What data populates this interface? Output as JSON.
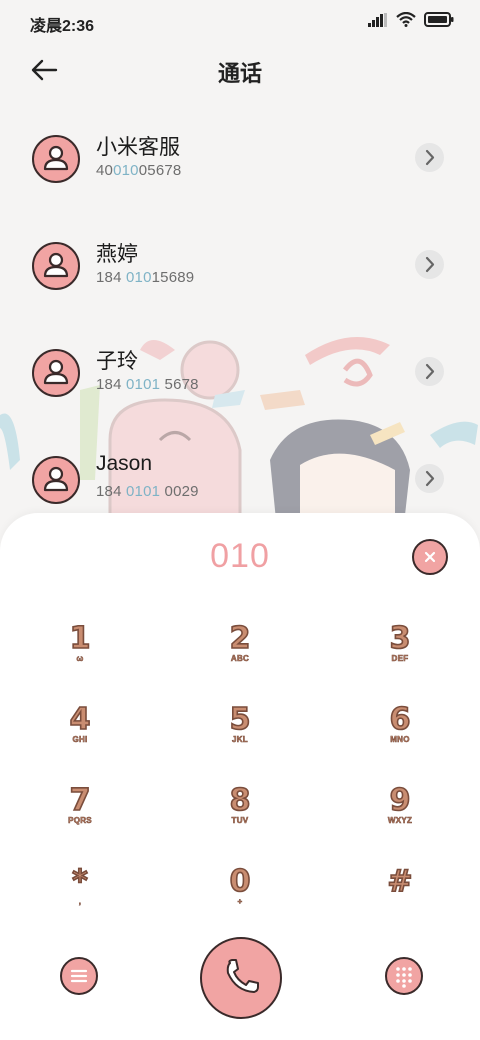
{
  "status_bar": {
    "time": "凌晨2:36"
  },
  "header": {
    "title": "通话"
  },
  "contacts": [
    {
      "name": "小米客服",
      "number_pre": "40",
      "number_hl": "010",
      "number_post": "05678"
    },
    {
      "name": "燕婷",
      "number_pre": "184 ",
      "number_hl": "010",
      "number_post": "15689"
    },
    {
      "name": "子玲",
      "number_pre": "184 ",
      "number_hl": "0101",
      "number_post": " 5678"
    },
    {
      "name": "Jason",
      "number_pre": "184 ",
      "number_hl": "0101",
      "number_post": " 0029"
    }
  ],
  "dialer": {
    "input": "010",
    "keys": [
      {
        "digit": "1",
        "letters": "ω"
      },
      {
        "digit": "2",
        "letters": "ABC"
      },
      {
        "digit": "3",
        "letters": "DEF"
      },
      {
        "digit": "4",
        "letters": "GHI"
      },
      {
        "digit": "5",
        "letters": "JKL"
      },
      {
        "digit": "6",
        "letters": "MNO"
      },
      {
        "digit": "7",
        "letters": "PQRS"
      },
      {
        "digit": "8",
        "letters": "TUV"
      },
      {
        "digit": "9",
        "letters": "WXYZ"
      },
      {
        "digit": "*",
        "letters": ","
      },
      {
        "digit": "0",
        "letters": "+"
      },
      {
        "digit": "#",
        "letters": ""
      }
    ]
  },
  "icons": {
    "back": "back-arrow-icon",
    "menu": "menu-icon",
    "call": "phone-icon",
    "keypad": "keypad-icon",
    "clear": "close-icon",
    "chevron": "chevron-right-icon",
    "avatar": "person-icon"
  },
  "colors": {
    "accent_pink": "#f1a4a3",
    "highlight_blue": "#7fb3c6",
    "digit_brown": "#c98d71",
    "outline": "#3a2a2a"
  }
}
